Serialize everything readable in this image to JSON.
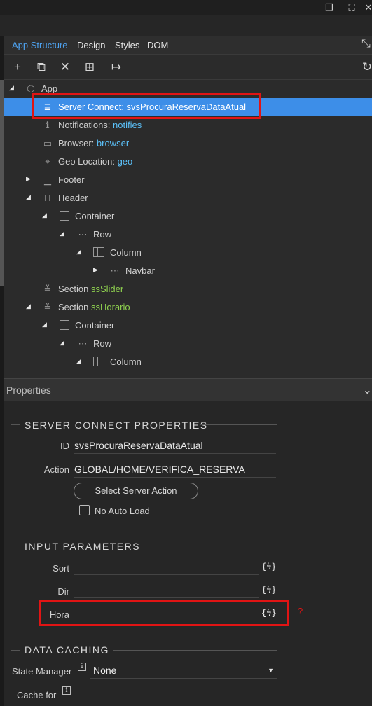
{
  "tabs": [
    "App Structure",
    "Design",
    "Styles",
    "DOM"
  ],
  "toolbar_icons": [
    "add-icon",
    "copy-icon",
    "delete-icon",
    "wrap-icon",
    "move-out-icon",
    "refresh-icon"
  ],
  "tree": {
    "app": "App",
    "server_connect": {
      "label": "Server Connect: ",
      "value": "svsProcuraReservaDataAtual"
    },
    "notifications": {
      "label": "Notifications: ",
      "value": "notifies"
    },
    "browser": {
      "label": "Browser: ",
      "value": "browser"
    },
    "geo": {
      "label": "Geo Location: ",
      "value": "geo"
    },
    "footer": "Footer",
    "header": "Header",
    "container1": "Container",
    "row1": "Row",
    "column1": "Column",
    "navbar": "Navbar",
    "section1": {
      "label": "Section ",
      "value": "ssSlider"
    },
    "section2": {
      "label": "Section ",
      "value": "ssHorario"
    },
    "container2": "Container",
    "row2": "Row",
    "column2": "Column"
  },
  "properties": {
    "header": "Properties",
    "server_connect_title": "SERVER CONNECT PROPERTIES",
    "id_label": "ID",
    "id_value": "svsProcuraReservaDataAtual",
    "action_label": "Action",
    "action_value": "GLOBAL/HOME/VERIFICA_RESERVA",
    "select_action_button": "Select Server Action",
    "no_auto_load": "No Auto Load",
    "input_params_title": "INPUT PARAMETERS",
    "params": [
      "Sort",
      "Dir",
      "Hora"
    ],
    "bolt_glyph": "{ϟ}",
    "data_caching_title": "DATA CACHING",
    "state_manager_label": "State Manager",
    "state_manager_value": "None",
    "cache_for_label": "Cache for",
    "info_glyph": "i",
    "question": "?"
  }
}
